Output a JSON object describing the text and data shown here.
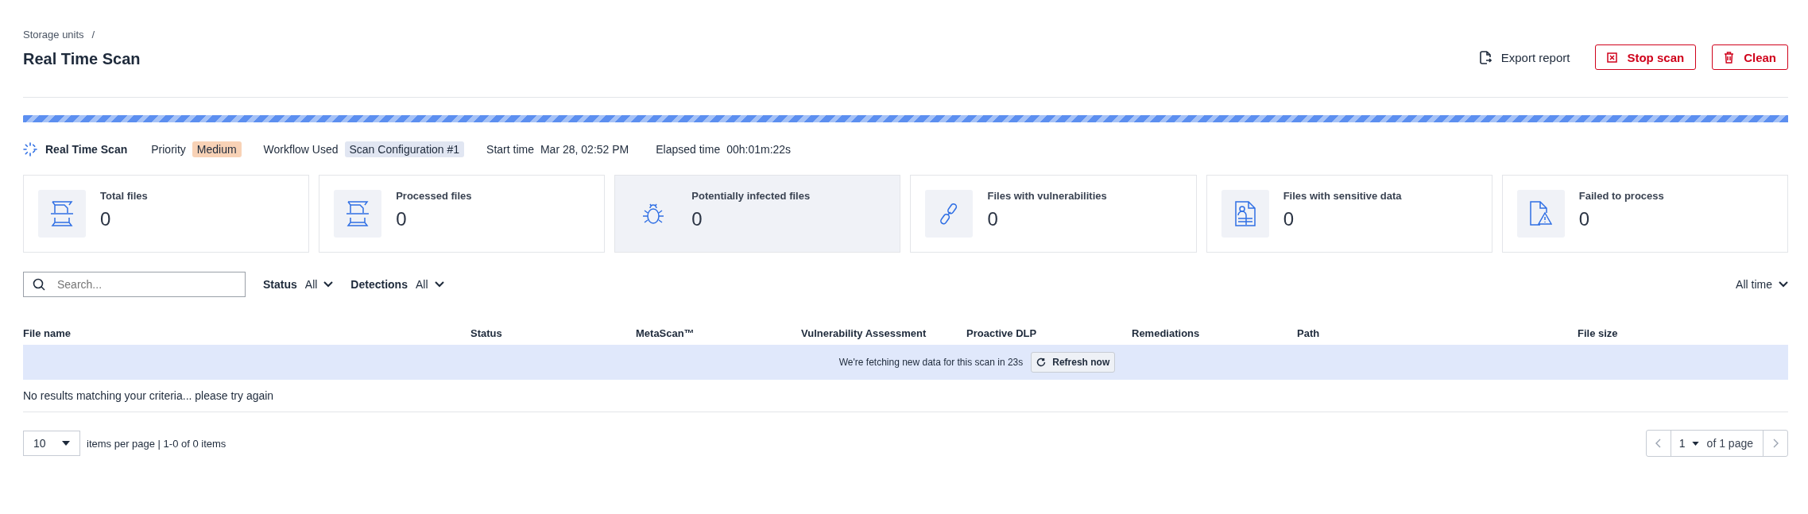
{
  "breadcrumb": {
    "items": [
      "Storage units"
    ],
    "separator": "/"
  },
  "title": "Real Time Scan",
  "progress": {
    "indeterminate": true
  },
  "actions": [
    {
      "kind": "link",
      "label": "Export report"
    },
    {
      "kind": "stop",
      "label": "Stop scan"
    },
    {
      "kind": "clean",
      "label": "Clean"
    }
  ],
  "scan_info": {
    "scan_type": "Real Time Scan",
    "priority_label": "Priority",
    "priority": "Medium",
    "workflow_label": "Workflow Used",
    "workflow": "Scan Configuration #1",
    "start_label": "Start time",
    "start": "Mar 28, 02:52 PM",
    "elapsed_label": "Elapsed time",
    "elapsed": "00h:01m:22s"
  },
  "stats": [
    {
      "kind": "scan",
      "label": "Total files",
      "value": "0",
      "selected": false
    },
    {
      "kind": "scan",
      "label": "Processed files",
      "value": "0",
      "selected": false
    },
    {
      "kind": "bug",
      "label": "Potentially infected files",
      "value": "0",
      "selected": true
    },
    {
      "kind": "link",
      "label": "Files with vulnerabilities",
      "value": "0",
      "selected": false
    },
    {
      "kind": "doc",
      "label": "Files with sensitive data",
      "value": "0",
      "selected": false
    },
    {
      "kind": "warn",
      "label": "Failed to process",
      "value": "0",
      "selected": false
    }
  ],
  "filters": {
    "search": {
      "placeholder": "Search..."
    },
    "dropdowns": [
      {
        "label": "Status",
        "value": "All"
      },
      {
        "label": "Detections",
        "value": "All"
      }
    ],
    "time_range": "All time"
  },
  "table": {
    "columns": [
      "File name",
      "Status",
      "MetaScan™",
      "Vulnerability Assessment",
      "Proactive DLP",
      "Remediations",
      "Path",
      "File size"
    ],
    "notice": {
      "message": "We're fetching new data for this scan in 23s",
      "button": "Refresh now"
    },
    "empty_message": "No results matching your criteria... please try again"
  },
  "pagination": {
    "per_page": "10",
    "summary": "items per page | 1-0 of 0 items",
    "page": "1",
    "of_pages": "of 1 page"
  }
}
